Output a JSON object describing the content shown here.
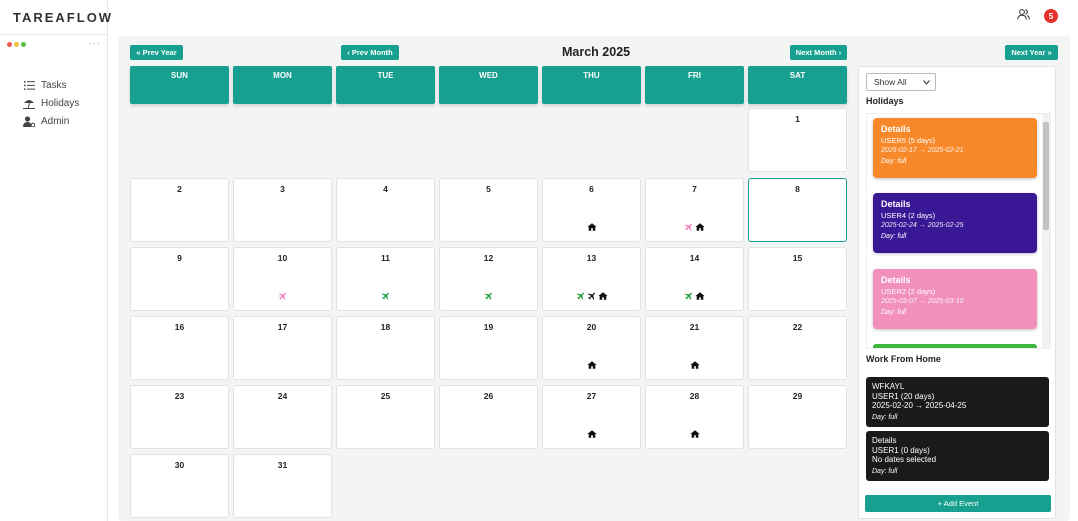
{
  "app": {
    "brand": "TAREAFLOW",
    "notification_count": "5"
  },
  "sidebar": {
    "items": [
      {
        "label": "Tasks",
        "icon": "list-icon"
      },
      {
        "label": "Holidays",
        "icon": "beach-umbrella-icon"
      },
      {
        "label": "Admin",
        "icon": "user-gear-icon"
      }
    ]
  },
  "nav": {
    "prev_year": "« Prev Year",
    "prev_month": "‹ Prev Month",
    "title": "March 2025",
    "next_month": "Next Month ›",
    "next_year": "Next Year »"
  },
  "calendar": {
    "weekdays": [
      "SUN",
      "MON",
      "TUE",
      "WED",
      "THU",
      "FRI",
      "SAT"
    ],
    "today": "8",
    "weeks": [
      [
        null,
        null,
        null,
        null,
        null,
        null,
        {
          "d": "1",
          "i": []
        }
      ],
      [
        {
          "d": "2",
          "i": []
        },
        {
          "d": "3",
          "i": []
        },
        {
          "d": "4",
          "i": []
        },
        {
          "d": "5",
          "i": []
        },
        {
          "d": "6",
          "i": [
            "home"
          ]
        },
        {
          "d": "7",
          "i": [
            "plane-pink",
            "home"
          ]
        },
        {
          "d": "8",
          "i": []
        }
      ],
      [
        {
          "d": "9",
          "i": []
        },
        {
          "d": "10",
          "i": [
            "plane-pink"
          ]
        },
        {
          "d": "11",
          "i": [
            "plane-green"
          ]
        },
        {
          "d": "12",
          "i": [
            "plane-green"
          ]
        },
        {
          "d": "13",
          "i": [
            "plane-green",
            "plane-black",
            "home"
          ]
        },
        {
          "d": "14",
          "i": [
            "plane-green",
            "home"
          ]
        },
        {
          "d": "15",
          "i": []
        }
      ],
      [
        {
          "d": "16",
          "i": []
        },
        {
          "d": "17",
          "i": []
        },
        {
          "d": "18",
          "i": []
        },
        {
          "d": "19",
          "i": []
        },
        {
          "d": "20",
          "i": [
            "home"
          ]
        },
        {
          "d": "21",
          "i": [
            "home"
          ]
        },
        {
          "d": "22",
          "i": []
        }
      ],
      [
        {
          "d": "23",
          "i": []
        },
        {
          "d": "24",
          "i": []
        },
        {
          "d": "25",
          "i": []
        },
        {
          "d": "26",
          "i": []
        },
        {
          "d": "27",
          "i": [
            "home"
          ]
        },
        {
          "d": "28",
          "i": [
            "home"
          ]
        },
        {
          "d": "29",
          "i": []
        }
      ],
      [
        {
          "d": "30",
          "i": []
        },
        {
          "d": "31",
          "i": []
        },
        null,
        null,
        null,
        null,
        null
      ]
    ]
  },
  "panel": {
    "filter_value": "Show All",
    "holidays_title": "Holidays",
    "holidays": [
      {
        "title": "Details",
        "user": "USER5 (5 days)",
        "dates": "2025-02-17 → 2025-02-21",
        "day": "Day: full",
        "color": "#f7892a"
      },
      {
        "title": "Details",
        "user": "USER4 (2 days)",
        "dates": "2025-02-24 → 2025-02-25",
        "day": "Day: full",
        "color": "#3a1895"
      },
      {
        "title": "Details",
        "user": "USER2 (2 days)",
        "dates": "2025-03-07 → 2025-03-10",
        "day": "Day: full",
        "color": "#f18fbd"
      }
    ],
    "wfh_title": "Work From Home",
    "wfh": [
      {
        "title": "WFKAYL",
        "user": "USER1 (20 days)",
        "dates": "2025-02-20 → 2025-04-25",
        "day": "Day: full"
      },
      {
        "title": "Details",
        "user": "USER1 (0 days)",
        "dates": "No dates selected",
        "day": "Day: full"
      }
    ],
    "add_event": "+ Add Event"
  },
  "colors": {
    "accent": "#17a08f",
    "plane_green": "#1a9a3a",
    "plane_pink": "#f07ab5",
    "black": "#111111"
  }
}
